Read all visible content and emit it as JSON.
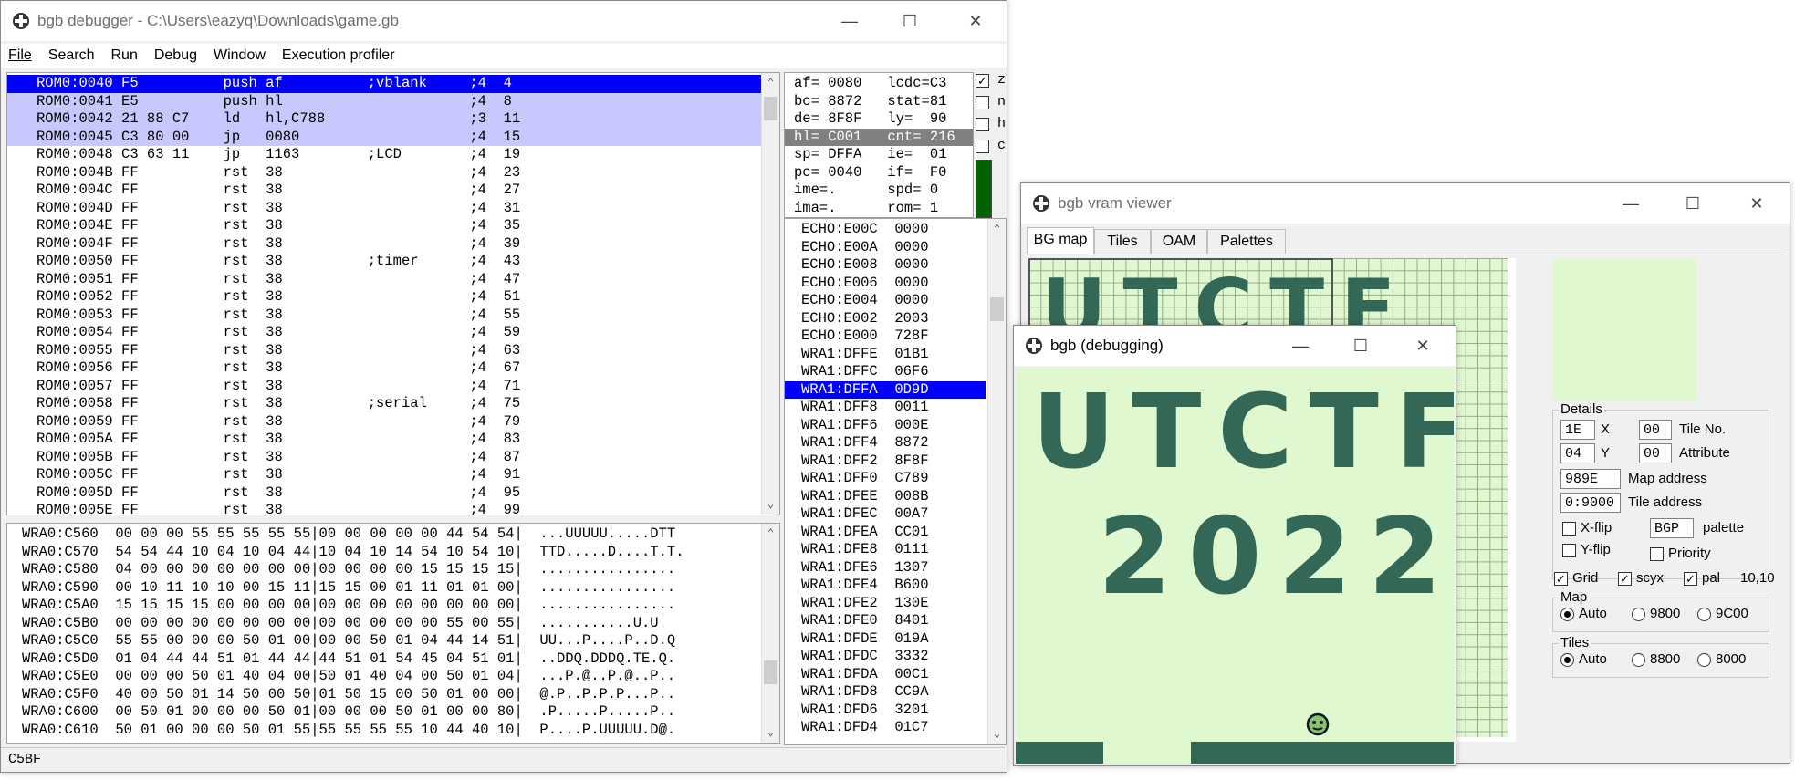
{
  "debugger": {
    "title": "bgb debugger - C:\\Users\\eazyq\\Downloads\\game.gb",
    "menu": [
      "File",
      "Search",
      "Run",
      "Debug",
      "Window",
      "Execution profiler"
    ],
    "disasm": [
      "ROM0:0040 F5          push af          ;vblank     ;4  4",
      "ROM0:0041 E5          push hl                      ;4  8",
      "ROM0:0042 21 88 C7    ld   hl,C788                 ;3  11",
      "ROM0:0045 C3 80 00    jp   0080                    ;4  15",
      "ROM0:0048 C3 63 11    jp   1163        ;LCD        ;4  19",
      "ROM0:004B FF          rst  38                      ;4  23",
      "ROM0:004C FF          rst  38                      ;4  27",
      "ROM0:004D FF          rst  38                      ;4  31",
      "ROM0:004E FF          rst  38                      ;4  35",
      "ROM0:004F FF          rst  38                      ;4  39",
      "ROM0:0050 FF          rst  38          ;timer      ;4  43",
      "ROM0:0051 FF          rst  38                      ;4  47",
      "ROM0:0052 FF          rst  38                      ;4  51",
      "ROM0:0053 FF          rst  38                      ;4  55",
      "ROM0:0054 FF          rst  38                      ;4  59",
      "ROM0:0055 FF          rst  38                      ;4  63",
      "ROM0:0056 FF          rst  38                      ;4  67",
      "ROM0:0057 FF          rst  38                      ;4  71",
      "ROM0:0058 FF          rst  38          ;serial     ;4  75",
      "ROM0:0059 FF          rst  38                      ;4  79",
      "ROM0:005A FF          rst  38                      ;4  83",
      "ROM0:005B FF          rst  38                      ;4  87",
      "ROM0:005C FF          rst  38                      ;4  91",
      "ROM0:005D FF          rst  38                      ;4  95",
      "ROM0:005E FF          rst  38                      ;4  99"
    ],
    "registers": [
      "af= 0080   lcdc=C3",
      "bc= 8872   stat=81",
      "de= 8F8F   ly=  90",
      "hl= C001   cnt= 216",
      "sp= DFFA   ie=  01",
      "pc= 0040   if=  F0",
      "ime=.      spd= 0",
      "ima=.      rom= 1"
    ],
    "flags": [
      "z",
      "n",
      "h",
      "c"
    ],
    "stack": [
      "ECHO:E00C  0000",
      "ECHO:E00A  0000",
      "ECHO:E008  0000",
      "ECHO:E006  0000",
      "ECHO:E004  0000",
      "ECHO:E002  2003",
      "ECHO:E000  728F",
      "WRA1:DFFE  01B1",
      "WRA1:DFFC  06F6",
      "WRA1:DFFA  0D9D",
      "WRA1:DFF8  0011",
      "WRA1:DFF6  000E",
      "WRA1:DFF4  8872",
      "WRA1:DFF2  8F8F",
      "WRA1:DFF0  C789",
      "WRA1:DFEE  008B",
      "WRA1:DFEC  00A7",
      "WRA1:DFEA  CC01",
      "WRA1:DFE8  0111",
      "WRA1:DFE6  1307",
      "WRA1:DFE4  B600",
      "WRA1:DFE2  130E",
      "WRA1:DFE0  8401",
      "WRA1:DFDE  019A",
      "WRA1:DFDC  3332",
      "WRA1:DFDA  00C1",
      "WRA1:DFD8  CC9A",
      "WRA1:DFD6  3201",
      "WRA1:DFD4  01C7"
    ],
    "memory": [
      "WRA0:C560  00 00 00 55 55 55 55 55|00 00 00 00 00 44 54 54|  ...UUUUU.....DTT",
      "WRA0:C570  54 54 44 10 04 10 04 44|10 04 10 14 54 10 54 10|  TTD.....D....T.T.",
      "WRA0:C580  04 00 00 00 00 00 00 00|00 00 00 00 15 15 15 15|  ................",
      "WRA0:C590  00 10 11 10 10 00 15 11|15 15 00 01 11 01 01 00|  ................",
      "WRA0:C5A0  15 15 15 15 00 00 00 00|00 00 00 00 00 00 00 00|  ................",
      "WRA0:C5B0  00 00 00 00 00 00 00 00|00 00 00 00 00 55 00 55|  ...........U.U",
      "WRA0:C5C0  55 55 00 00 00 50 01 00|00 00 50 01 04 44 14 51|  UU...P....P..D.Q",
      "WRA0:C5D0  01 04 44 44 51 01 44 44|44 51 01 54 45 04 51 01|  ..DDQ.DDDQ.TE.Q.",
      "WRA0:C5E0  00 00 00 50 01 40 04 00|50 01 40 04 00 50 01 04|  ...P.@..P.@..P..",
      "WRA0:C5F0  40 00 50 01 14 50 00 50|01 50 15 00 50 01 00 00|  @.P..P.P.P...P..",
      "WRA0:C600  00 50 01 00 00 00 50 01|00 00 00 50 01 00 00 80|  .P.....P.....P..",
      "WRA0:C610  50 01 00 00 00 50 01 55|55 55 55 55 10 44 40 10|  P....P.UUUUU.D@."
    ],
    "status": "C5BF"
  },
  "vram": {
    "title": "bgb vram viewer",
    "tabs": [
      "BG map",
      "Tiles",
      "OAM",
      "Palettes"
    ],
    "details_label": "Details",
    "tile_x": "1E",
    "tile_y": "04",
    "x_label": "X",
    "y_label": "Y",
    "tile_no": "00",
    "tile_no_label": "Tile No.",
    "attribute": "00",
    "attribute_label": "Attribute",
    "map_address": "989E",
    "map_address_label": "Map address",
    "tile_address": "0:9000",
    "tile_address_label": "Tile address",
    "xflip_label": "X-flip",
    "yflip_label": "Y-flip",
    "palette_value": "BGP",
    "palette_label": "palette",
    "priority_label": "Priority",
    "grid_label": "Grid",
    "scyx_label": "scyx",
    "pal_label": "pal",
    "coords": "10,10",
    "map_label": "Map",
    "map_options": [
      "Auto",
      "9800",
      "9C00"
    ],
    "tiles_label": "Tiles",
    "tiles_options": [
      "Auto",
      "8800",
      "8000"
    ]
  },
  "game": {
    "title": "bgb (debugging)",
    "line1": "UTCTF",
    "line2": "2022"
  },
  "colors": {
    "selection": "#0000ff",
    "highlight": "#c8c8ff",
    "gb_light": "#e0f8d0",
    "gb_dark": "#346856"
  }
}
